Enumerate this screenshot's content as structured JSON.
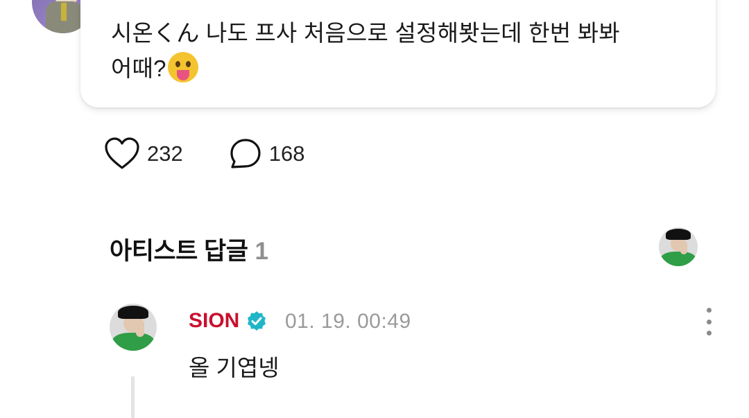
{
  "post": {
    "line1": "시온くん 나도 프사 처음으로 설정해봣는데 한번 봐봐",
    "line2": "어때?"
  },
  "stats": {
    "likes": "232",
    "comments": "168"
  },
  "artist_section": {
    "title": "아티스트 답글",
    "count": "1"
  },
  "reply": {
    "name": "SION",
    "timestamp": "01. 19. 00:49",
    "text": "올 기엽넹"
  },
  "icons": {
    "like": "heart-icon",
    "comment": "comment-bubble-icon",
    "verified": "verified-badge-icon",
    "more": "more-vertical-icon"
  },
  "colors": {
    "artist_name": "#c8102e",
    "verified_badge": "#1fb6c8",
    "muted_text": "#9a9a9a"
  }
}
